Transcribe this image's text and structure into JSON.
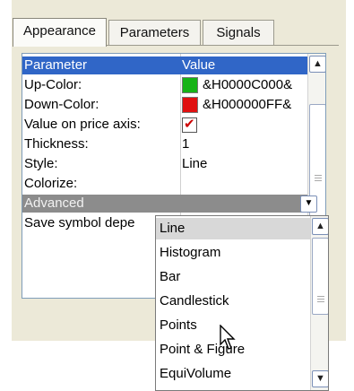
{
  "tabs": [
    "Appearance",
    "Parameters",
    "Signals"
  ],
  "grid": {
    "header": {
      "name": "Parameter",
      "value": "Value"
    },
    "rows": [
      {
        "name": "Up-Color:",
        "value": "&H0000C000&",
        "swatch": "#16b316"
      },
      {
        "name": "Down-Color:",
        "value": "&H000000FF&",
        "swatch": "#e01010"
      },
      {
        "name": "Value on price axis:",
        "checked": true
      },
      {
        "name": "Thickness:",
        "value": "1"
      },
      {
        "name": "Style:",
        "value": "Line"
      },
      {
        "name": "Colorize:"
      },
      {
        "name": "Advanced"
      },
      {
        "name": "Save symbol depe"
      }
    ]
  },
  "dropdown": {
    "items": [
      "Line",
      "Histogram",
      "Bar",
      "Candlestick",
      "Points",
      "Point & Figure",
      "EquiVolume"
    ],
    "selected_index": 0
  },
  "colors": {
    "header_bg": "#3066c7",
    "selected_row_bg": "#8c8c8c"
  }
}
